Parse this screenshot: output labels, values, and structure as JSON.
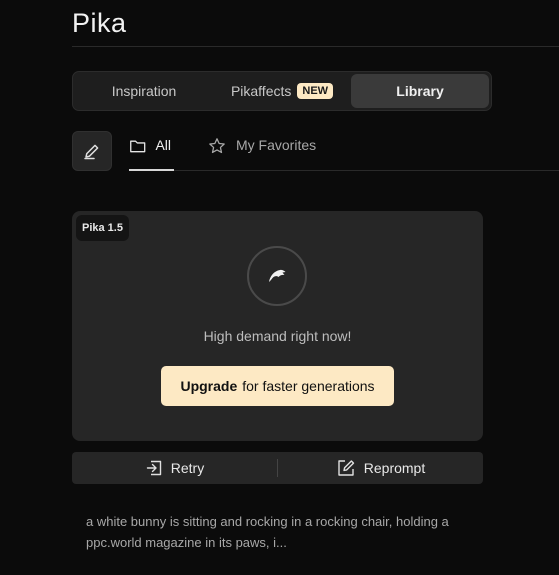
{
  "app": {
    "logo": "Pika"
  },
  "tabs": [
    {
      "label": "Inspiration"
    },
    {
      "label": "Pikaffects",
      "badge": "NEW"
    },
    {
      "label": "Library",
      "active": true
    }
  ],
  "filters": [
    {
      "label": "All",
      "icon": "folder-icon",
      "active": true
    },
    {
      "label": "My Favorites",
      "icon": "star-icon"
    }
  ],
  "card": {
    "model_badge": "Pika 1.5",
    "status_text": "High demand right now!",
    "upgrade_bold": "Upgrade",
    "upgrade_rest": "for faster generations"
  },
  "actions": {
    "retry": "Retry",
    "reprompt": "Reprompt"
  },
  "prompt_text": "a white bunny is sitting and rocking in a rocking chair, holding a ppc.world magazine in its paws, i...",
  "colors": {
    "background": "#0b0b0b",
    "accent": "#fde9c4",
    "card": "#262626"
  }
}
